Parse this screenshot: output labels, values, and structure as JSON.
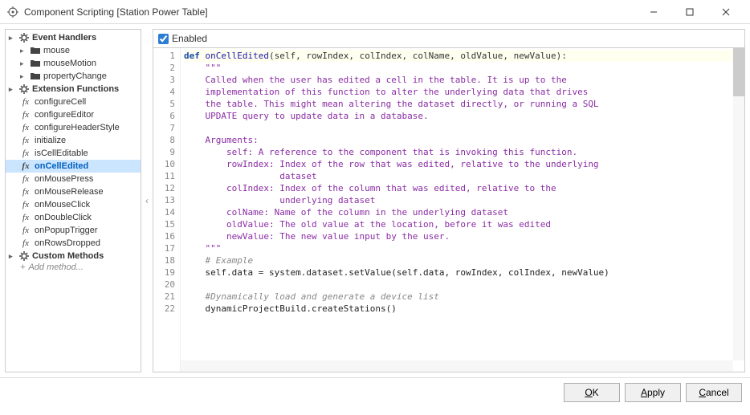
{
  "window": {
    "title": "Component Scripting [Station Power Table]"
  },
  "sidebar": {
    "sections": [
      {
        "label": "Event Handlers",
        "type": "root"
      },
      {
        "label": "mouse",
        "type": "folder"
      },
      {
        "label": "mouseMotion",
        "type": "folder"
      },
      {
        "label": "propertyChange",
        "type": "folder"
      },
      {
        "label": "Extension Functions",
        "type": "root"
      },
      {
        "label": "configureCell",
        "type": "fx"
      },
      {
        "label": "configureEditor",
        "type": "fx"
      },
      {
        "label": "configureHeaderStyle",
        "type": "fx"
      },
      {
        "label": "initialize",
        "type": "fx"
      },
      {
        "label": "isCellEditable",
        "type": "fx"
      },
      {
        "label": "onCellEdited",
        "type": "fx",
        "selected": true
      },
      {
        "label": "onMousePress",
        "type": "fx"
      },
      {
        "label": "onMouseRelease",
        "type": "fx"
      },
      {
        "label": "onMouseClick",
        "type": "fx"
      },
      {
        "label": "onDoubleClick",
        "type": "fx"
      },
      {
        "label": "onPopupTrigger",
        "type": "fx"
      },
      {
        "label": "onRowsDropped",
        "type": "fx"
      },
      {
        "label": "Custom Methods",
        "type": "root"
      }
    ],
    "add_method": "Add method..."
  },
  "editor": {
    "enabled_label": "Enabled",
    "enabled_checked": true,
    "lines": [
      "def onCellEdited(self, rowIndex, colIndex, colName, oldValue, newValue):",
      "\t\"\"\"",
      "\tCalled when the user has edited a cell in the table. It is up to the",
      "\timplementation of this function to alter the underlying data that drives",
      "\tthe table. This might mean altering the dataset directly, or running a SQL",
      "\tUPDATE query to update data in a database.",
      "",
      "\tArguments:",
      "\t\tself: A reference to the component that is invoking this function.",
      "\t\trowIndex: Index of the row that was edited, relative to the underlying",
      "\t\t          dataset",
      "\t\tcolIndex: Index of the column that was edited, relative to the",
      "\t\t          underlying dataset",
      "\t\tcolName: Name of the column in the underlying dataset",
      "\t\toldValue: The old value at the location, before it was edited",
      "\t\tnewValue: The new value input by the user.",
      "\t\"\"\"",
      "\t# Example",
      "\tself.data = system.dataset.setValue(self.data, rowIndex, colIndex, newValue)",
      "",
      "\t#Dynamically load and generate a device list",
      "\tdynamicProjectBuild.createStations()"
    ]
  },
  "footer": {
    "ok": "OK",
    "apply": "Apply",
    "cancel": "Cancel"
  }
}
